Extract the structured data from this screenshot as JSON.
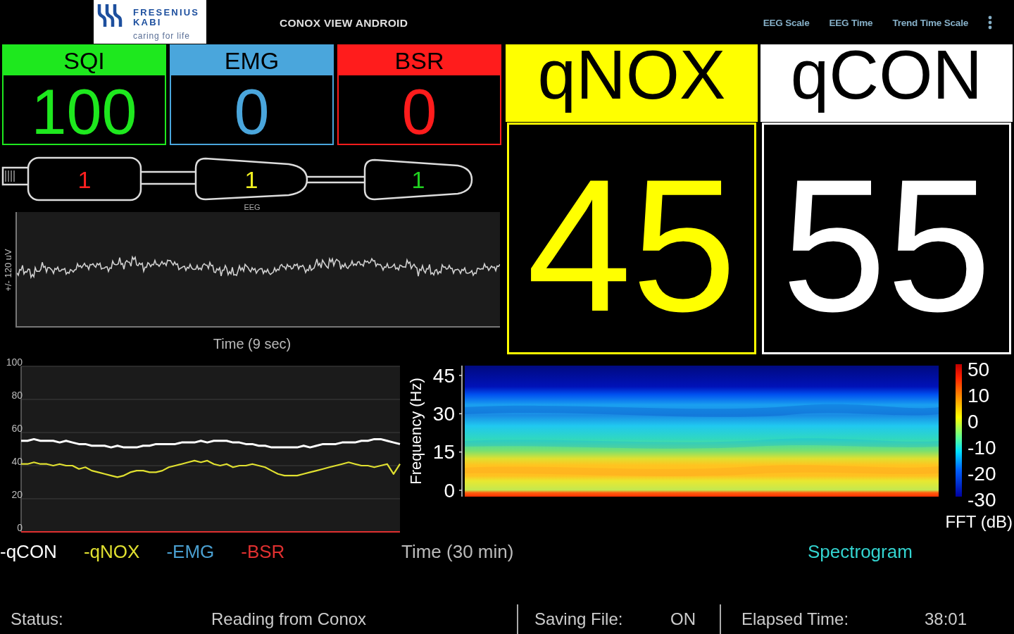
{
  "app_bar": {
    "logo": {
      "brand_lines": [
        "FRESENIUS",
        "KABI"
      ],
      "tagline": "caring for life"
    },
    "title": "CONOX VIEW ANDROID",
    "actions": [
      "EEG Scale",
      "EEG Time",
      "Trend Time Scale"
    ]
  },
  "indices": [
    {
      "label": "SQI",
      "value": "100",
      "color": "#1ee81e"
    },
    {
      "label": "EMG",
      "value": "0",
      "color": "#4aa6dc"
    },
    {
      "label": "BSR",
      "value": "0",
      "color": "#ff1c1c"
    }
  ],
  "main_indices": [
    {
      "label": "qNOX",
      "value": "45",
      "color": "#ffff00"
    },
    {
      "label": "qCON",
      "value": "55",
      "color": "#ffffff"
    }
  ],
  "sensor": {
    "electrodes": [
      {
        "value": "1",
        "color": "#ff2020"
      },
      {
        "value": "1",
        "color": "#f0f020"
      },
      {
        "value": "1",
        "color": "#20d020"
      }
    ],
    "label": "EEG"
  },
  "eeg": {
    "y_label": "+/- 120 uV",
    "x_label": "Time (9 sec)"
  },
  "trend": {
    "chart_data": [
      {
        "type": "line",
        "ylim": [
          0,
          100
        ],
        "yticks": [
          0,
          20,
          40,
          60,
          80,
          100
        ],
        "grid": true,
        "series": [
          {
            "name": "-qCON",
            "color": "#ffffff",
            "values": [
              55,
              55,
              56,
              55,
              55,
              55,
              54,
              55,
              54,
              53,
              53,
              52,
              52,
              52,
              51,
              52,
              51,
              51,
              51,
              52,
              52,
              53,
              53,
              53,
              53,
              54,
              54,
              54,
              55,
              54,
              55,
              55,
              55,
              54,
              54,
              53,
              53,
              52,
              52,
              51,
              51,
              51,
              51,
              51,
              52,
              51,
              52,
              53,
              53,
              53,
              54,
              54,
              54,
              55,
              55,
              56,
              56,
              55,
              54,
              53
            ]
          },
          {
            "name": "-qNOX",
            "color": "#e0e030",
            "values": [
              41,
              41,
              42,
              41,
              41,
              40,
              41,
              40,
              40,
              38,
              39,
              37,
              36,
              35,
              34,
              33,
              34,
              36,
              37,
              37,
              36,
              36,
              37,
              39,
              40,
              41,
              42,
              43,
              42,
              43,
              41,
              40,
              41,
              39,
              40,
              40,
              41,
              40,
              39,
              37,
              35,
              34,
              34,
              34,
              35,
              36,
              37,
              38,
              39,
              40,
              41,
              42,
              41,
              40,
              40,
              39,
              40,
              41,
              35,
              41
            ]
          },
          {
            "name": "-EMG",
            "color": "#4a9fd0",
            "values": [
              null,
              null,
              null,
              null,
              null,
              null,
              null,
              null,
              null,
              null,
              null,
              null,
              null,
              null,
              null,
              null,
              null,
              null,
              null,
              null,
              null,
              null,
              null,
              null,
              null,
              null,
              null,
              null,
              null,
              null,
              null,
              null,
              null,
              null,
              null,
              null,
              null,
              null,
              null,
              null,
              null,
              null,
              null,
              null,
              null,
              null,
              null,
              null,
              null,
              null,
              null,
              null,
              null,
              null,
              null,
              null,
              null,
              null,
              null,
              null
            ]
          },
          {
            "name": "-BSR",
            "color": "#e03030",
            "values": [
              0,
              0,
              0,
              0,
              0,
              0,
              0,
              0,
              0,
              0,
              0,
              0,
              0,
              0,
              0,
              0,
              0,
              0,
              0,
              0,
              0,
              0,
              0,
              0,
              0,
              0,
              0,
              0,
              0,
              0,
              0,
              0,
              0,
              0,
              0,
              0,
              0,
              0,
              0,
              0,
              0,
              0,
              0,
              0,
              0,
              0,
              0,
              0,
              0,
              0,
              0,
              0,
              0,
              0,
              0,
              0,
              0,
              0,
              0,
              0
            ]
          }
        ]
      }
    ]
  },
  "spectrogram": {
    "frequency_label": "Frequency (Hz)",
    "frequency_ticks": [
      "45",
      "30",
      "15",
      "0"
    ],
    "scale_ticks": [
      "50",
      "10",
      "0",
      "-10",
      "-20",
      "-30"
    ],
    "scale_label": "FFT (dB)",
    "time_label": "Time (30 min)",
    "title": "Spectrogram"
  },
  "status_bar": [
    {
      "label": "Status:",
      "value": "Reading from Conox"
    },
    {
      "label": "Saving File:",
      "value": "ON"
    },
    {
      "label": "Elapsed Time:",
      "value": "38:01"
    }
  ]
}
